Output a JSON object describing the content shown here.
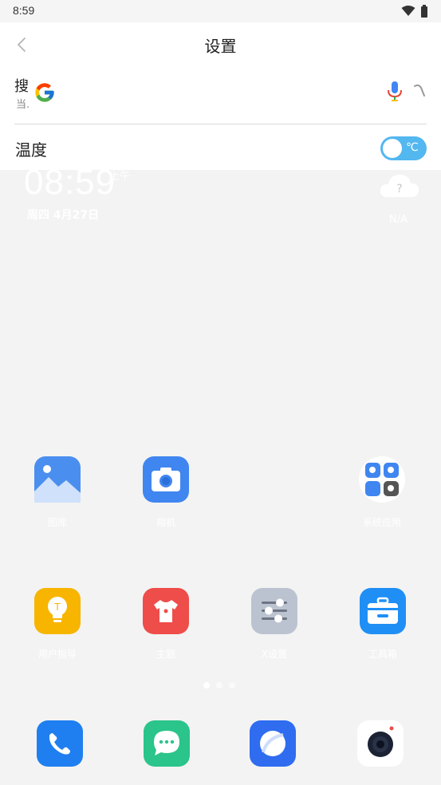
{
  "status_bar": {
    "time": "8:59",
    "wifi_icon": "wifi-icon",
    "battery_icon": "battery-icon"
  },
  "header": {
    "title": "设置",
    "back_icon": "chevron-left-icon"
  },
  "search": {
    "clip_text_top": "搜",
    "clip_text_bottom": "当.",
    "logo": "google-logo",
    "mic_icon": "microphone-icon",
    "lens_icon": "lens-icon"
  },
  "temperature": {
    "label": "温度",
    "unit": "℃",
    "enabled": true,
    "accent": "#53b7f0"
  },
  "widget": {
    "time": "08:59",
    "ampm": "上午",
    "date": "周四 4月27日",
    "weather_icon": "cloud-question-icon",
    "weather_status": "N/A"
  },
  "apps": {
    "row1": [
      {
        "label": "图库",
        "icon": "gallery-icon",
        "color": "#4a8ff0"
      },
      {
        "label": "相机",
        "icon": "camera-icon",
        "color": "#3f86f0"
      },
      {
        "label": "系统应用",
        "icon": "system-apps-folder-icon",
        "color": "#ffffff"
      }
    ],
    "row2": [
      {
        "label": "用户指导",
        "icon": "lightbulb-icon",
        "color": "#f7b500"
      },
      {
        "label": "主题",
        "icon": "shirt-icon",
        "color": "#ee4d4a"
      },
      {
        "label": "X设置",
        "icon": "sliders-icon",
        "color": "#bcc3d0"
      },
      {
        "label": "工具箱",
        "icon": "toolbox-icon",
        "color": "#1f8ff5"
      }
    ]
  },
  "dock": [
    {
      "icon": "phone-icon",
      "color": "#1f7ff0"
    },
    {
      "icon": "messages-icon",
      "color": "#2bc48a"
    },
    {
      "icon": "browser-icon",
      "color": "#2f6cf0"
    },
    {
      "icon": "camera-lens-icon",
      "color": "#ffffff"
    }
  ]
}
